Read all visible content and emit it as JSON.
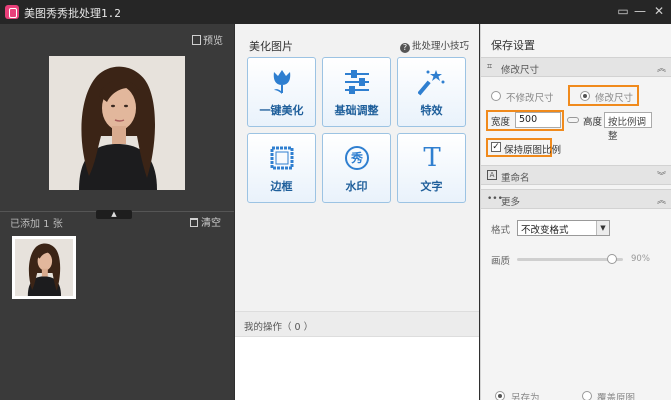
{
  "window": {
    "title": "美图秀秀批处理1.2",
    "buttons": [
      "▭",
      "—",
      "✕"
    ]
  },
  "left_panel": {
    "preview_label": "预览",
    "added_label": "已添加 1 张",
    "clear_label": "清空",
    "collapse_glyph": "▲"
  },
  "center_panel": {
    "title": "美化图片",
    "tips_label": "批处理小技巧",
    "tools": [
      {
        "label": "一键美化",
        "icon": "tulip-icon"
      },
      {
        "label": "基础调整",
        "icon": "sliders-icon"
      },
      {
        "label": "特效",
        "icon": "magic-wand-icon"
      },
      {
        "label": "边框",
        "icon": "frame-icon"
      },
      {
        "label": "水印",
        "icon": "watermark-icon"
      },
      {
        "label": "文字",
        "icon": "text-icon"
      }
    ],
    "watermark_glyph": "秀",
    "text_glyph": "T",
    "ops_label": "我的操作（ 0 ）"
  },
  "right_panel": {
    "title": "保存设置",
    "resize_section": "修改尺寸",
    "no_resize_label": "不修改尺寸",
    "resize_label": "修改尺寸",
    "width_label": "宽度",
    "width_value": "500",
    "height_label": "高度",
    "height_value": "按比例调整",
    "keep_ratio_label": "保持原图比例",
    "keep_ratio_checked": true,
    "rename_section": "重命名",
    "more_section": "更多",
    "format_label": "格式",
    "format_value": "不改变格式",
    "quality_label": "画质",
    "quality_value": "90%",
    "quality_level": 0.9,
    "save_as_label": "另存为",
    "overwrite_label": "覆盖原图"
  },
  "colors": {
    "highlight": "#f08a1c",
    "tool_label": "#1f5f9b",
    "tool_border": "#9cc3e3"
  }
}
